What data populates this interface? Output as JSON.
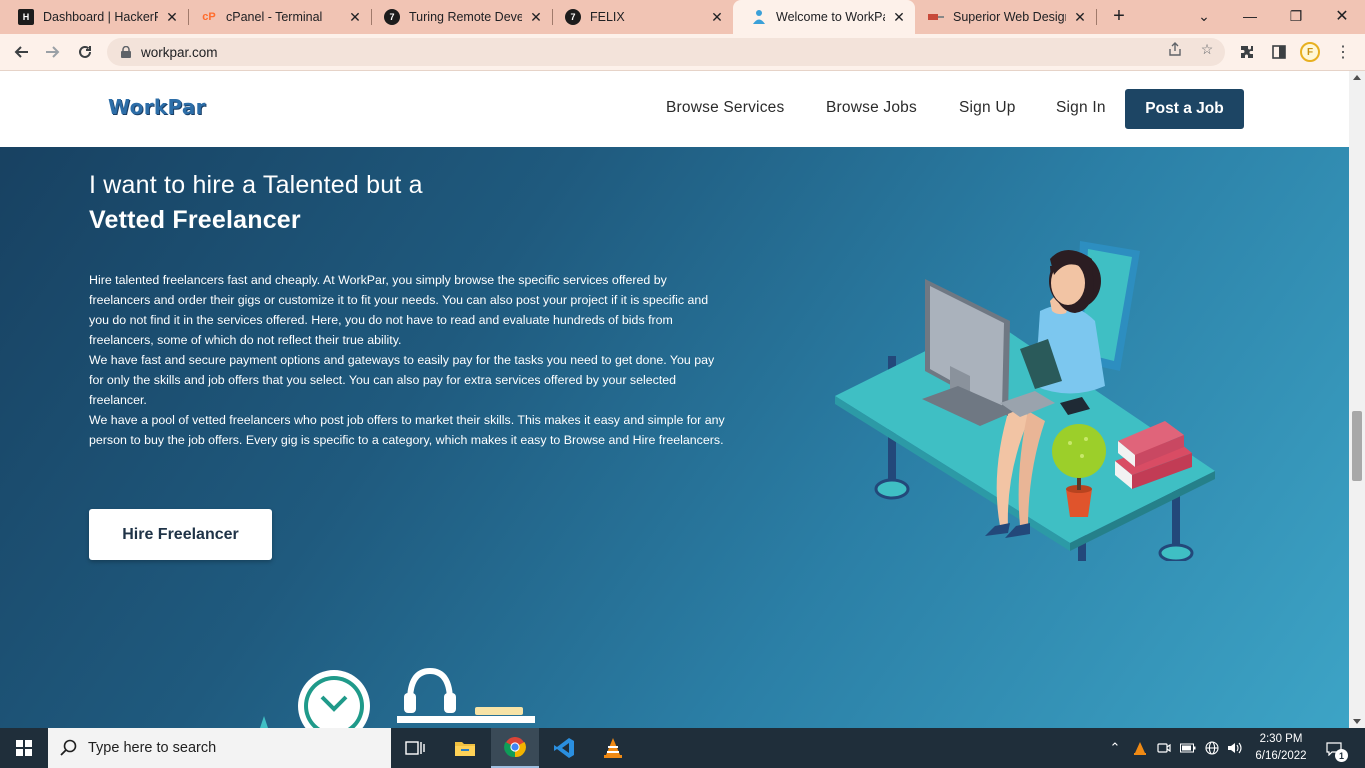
{
  "browser": {
    "tabs": [
      {
        "title": "Dashboard | HackerRa",
        "icon": "hackerrank-icon",
        "active": false
      },
      {
        "title": "cPanel - Terminal",
        "icon": "cpanel-icon",
        "active": false
      },
      {
        "title": "Turing Remote Develo",
        "icon": "turing-icon",
        "active": false
      },
      {
        "title": "FELIX",
        "icon": "turing-icon",
        "active": false
      },
      {
        "title": "Welcome to WorkPar",
        "icon": "workpar-icon",
        "active": true
      },
      {
        "title": "Superior Web Designe",
        "icon": "web-designer-icon",
        "active": false
      }
    ],
    "new_tab": "+",
    "url": "workpar.com",
    "profile_initial": "F"
  },
  "site": {
    "logo": "WorkPar",
    "nav": {
      "browse_services": "Browse Services",
      "browse_jobs": "Browse Jobs",
      "sign_up": "Sign Up",
      "sign_in": "Sign In",
      "post_job": "Post a Job"
    },
    "hero": {
      "title_line1": "I want to hire a Talented but a",
      "title_line2": "Vetted Freelancer",
      "paragraph1": "Hire talented freelancers fast and cheaply. At WorkPar, you simply browse the specific services offered by freelancers and order their gigs or customize it to fit your needs. You can also post your project if it is specific and you do not find it in the services offered. Here, you do not have to read and evaluate hundreds of bids from freelancers, some of which do not reflect their true ability.",
      "paragraph2": "We have fast and secure payment options and gateways to easily pay for the tasks you need to get done. You pay for only the skills and job offers that you select. You can also pay for extra services offered by your selected freelancer.",
      "paragraph3": "We have a pool of vetted freelancers who post job offers to market their skills. This makes it easy and simple for any person to buy the job offers. Every gig is specific to a category, which makes it easy to Browse and Hire freelancers.",
      "cta": "Hire Freelancer"
    }
  },
  "taskbar": {
    "search_placeholder": "Type here to search",
    "time": "2:30 PM",
    "date": "6/16/2022",
    "notification_count": "1"
  },
  "colors": {
    "tabbar": "#f1c4b4",
    "toolbar": "#fdf1ea",
    "header_button": "#1d4564",
    "hero_dark": "#173f5f",
    "hero_light": "#3da4c6",
    "desk": "#3fbfc4",
    "taskbar": "#1f2e3a"
  }
}
